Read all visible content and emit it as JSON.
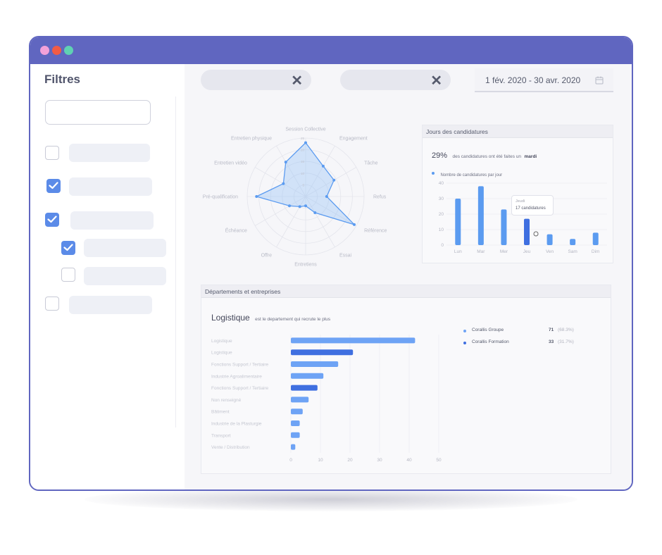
{
  "window": {
    "titlebar_color": "#6066c0",
    "dots": [
      "#f3a1d9",
      "#f15b45",
      "#5fd1b3"
    ]
  },
  "sidebar": {
    "title": "Filtres"
  },
  "date_range": {
    "value": "1 fév. 2020 - 30 avr. 2020"
  },
  "radar": {
    "axes": [
      "Session Collective",
      "Engagement",
      "Tâche",
      "Refus",
      "Référence",
      "Essai",
      "Entretiens",
      "Offre",
      "Échéance",
      "Pré-qualification",
      "Entretien vidéo",
      "Entretien physique"
    ],
    "scale_ticks": [
      "5",
      "10",
      "15",
      "20",
      "25"
    ],
    "max": 25,
    "values": [
      23,
      15,
      14,
      9,
      24,
      8,
      4,
      5,
      8,
      21,
      11,
      17
    ],
    "color": "#5b9bf0"
  },
  "jours": {
    "title": "Jours des candidatures",
    "stat_percent": "29%",
    "stat_text": "des candidatures ont été faites un",
    "stat_day": "mardi",
    "legend": "Nombre de candidatures par jour",
    "chart_data": {
      "type": "bar",
      "categories": [
        "Lun",
        "Mar",
        "Mer",
        "Jeu",
        "Ven",
        "Sam",
        "Dim"
      ],
      "values": [
        30,
        38,
        23,
        17,
        7,
        4,
        8
      ],
      "y_ticks": [
        "0",
        "10",
        "20",
        "30",
        "40"
      ],
      "ylim": [
        0,
        40
      ]
    },
    "tooltip": {
      "day": "Jeudi",
      "text": "17 candidatures"
    }
  },
  "departements": {
    "title": "Départements et entreprises",
    "highlight": "Logistique",
    "highlight_text": "est le departement qui recrute le plus",
    "chart_data": {
      "type": "bar",
      "orientation": "horizontal",
      "categories": [
        "Logistique",
        "Logistique",
        "Fonctions Support / Tertiaire",
        "Industrie Agroalimentaire",
        "Fonctions Support / Tertiaire",
        "Non renseigné",
        "Bâtiment",
        "Industrie de la Plasturgie",
        "Transport",
        "Vente / Distribution"
      ],
      "values": [
        42,
        21,
        16,
        11,
        9,
        6,
        4,
        3,
        3,
        1.5
      ],
      "series_index": [
        0,
        1,
        0,
        0,
        1,
        0,
        0,
        0,
        0,
        0
      ],
      "x_ticks": [
        "0",
        "10",
        "20",
        "30",
        "40",
        "50"
      ],
      "xlim": [
        0,
        50
      ]
    },
    "legend": [
      {
        "name": "Corallis Groupe",
        "count": "71",
        "pct": "(68.3%)",
        "color": "#6ea3f5"
      },
      {
        "name": "Corallis Formation",
        "count": "33",
        "pct": "(31.7%)",
        "color": "#3f6fe0"
      }
    ]
  }
}
